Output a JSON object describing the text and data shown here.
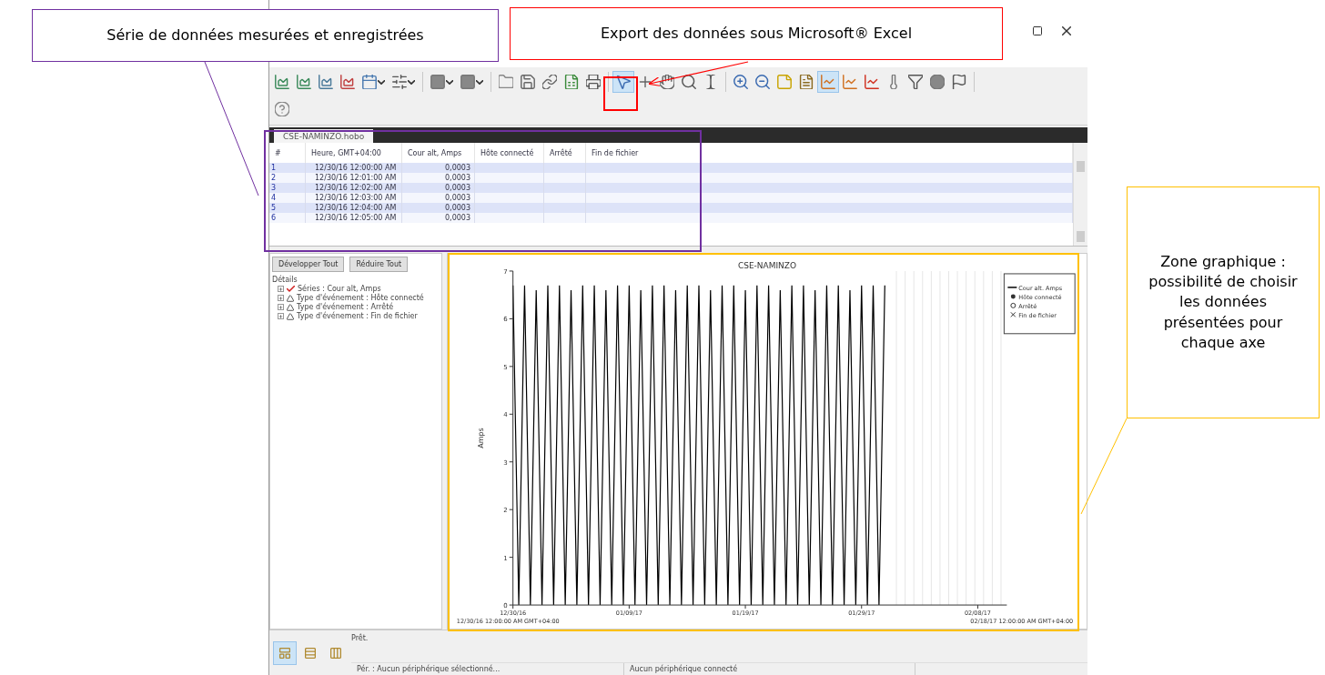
{
  "annotations": [
    {
      "text": "Série de données mesurées et enregistrées",
      "color": "#7030a0"
    },
    {
      "text": "Export des données sous Microsoft® Excel",
      "color": "#ff0000"
    },
    {
      "text": "Zone graphique : possibilité de choisir les données présentées pour chaque axe",
      "color": "#ffc000"
    }
  ],
  "toolbar_rows": [
    [
      {
        "selected": false
      },
      {
        "selected": false
      },
      {
        "selected": false
      },
      {
        "selected": false
      },
      {
        "selected": false
      },
      {
        "selected": false
      },
      {
        "selected": false
      },
      {
        "selected": false
      },
      {
        "selected": false
      },
      {
        "selected": false
      },
      {
        "selected": false
      },
      {
        "selected": false
      },
      {
        "selected": false
      },
      {
        "selected": true
      },
      {
        "selected": false
      },
      {
        "selected": false
      },
      {
        "selected": false
      },
      {
        "selected": false
      },
      {
        "selected": false
      },
      {
        "selected": false
      },
      {
        "selected": false
      },
      {
        "selected": false
      },
      {
        "selected": true
      },
      {
        "selected": false
      },
      {
        "selected": false
      },
      {
        "selected": false
      },
      {
        "selected": false
      },
      {
        "selected": false
      },
      {
        "selected": false
      }
    ],
    [
      {
        "selected": false
      }
    ]
  ],
  "document_tab": {
    "label": "CSE-NAMINZO.hobo",
    "selected": true
  },
  "table": {
    "columns": [
      "#",
      "Heure, GMT+04:00",
      "Cour alt, Amps",
      "Hôte connecté",
      "Arrêté",
      "Fin de fichier"
    ],
    "rows": [
      [
        "1",
        "12/30/16 12:00:00 AM",
        "0,0003",
        "",
        "",
        ""
      ],
      [
        "2",
        "12/30/16 12:01:00 AM",
        "0,0003",
        "",
        "",
        ""
      ],
      [
        "3",
        "12/30/16 12:02:00 AM",
        "0,0003",
        "",
        "",
        ""
      ],
      [
        "4",
        "12/30/16 12:03:00 AM",
        "0,0003",
        "",
        "",
        ""
      ],
      [
        "5",
        "12/30/16 12:04:00 AM",
        "0,0003",
        "",
        "",
        ""
      ],
      [
        "6",
        "12/30/16 12:05:00 AM",
        "0,0003",
        "",
        "",
        ""
      ]
    ]
  },
  "details": {
    "buttons": [
      "Développer Tout",
      "Réduire Tout"
    ],
    "heading": "Détails",
    "items": [
      {
        "kind": "series",
        "label": "Séries : Cour alt, Amps",
        "expanded": false
      },
      {
        "kind": "event",
        "label": "Type d'événement : Hôte connecté",
        "expanded": false
      },
      {
        "kind": "event",
        "label": "Type d'événement : Arrêté",
        "expanded": false
      },
      {
        "kind": "event",
        "label": "Type d'événement : Fin de fichier",
        "expanded": false
      }
    ]
  },
  "chart": {
    "start_label": "12/30/16 12:00:00 AM GMT+04:00",
    "end_label": "02/18/17 12:00:00 AM GMT+04:00",
    "legend": [
      {
        "kind": "star",
        "label": "Hôte connecté"
      },
      {
        "kind": "circle",
        "label": "Arrêté"
      },
      {
        "kind": "cross",
        "label": "Fin de fichier"
      }
    ],
    "chart_data": {
      "type": "line",
      "grid": true,
      "title": "CSE-NAMINZO",
      "ylabel": "Amps",
      "ylim": [
        0,
        7
      ],
      "yticks": [
        0,
        1,
        2,
        3,
        4,
        5,
        6,
        7
      ],
      "categories": [
        "12/30/16",
        null,
        null,
        null,
        null,
        null,
        null,
        null,
        null,
        null,
        null,
        null,
        null,
        null,
        null,
        null,
        null,
        null,
        null,
        null,
        "01/09/17",
        null,
        null,
        null,
        null,
        null,
        null,
        null,
        null,
        null,
        null,
        null,
        null,
        null,
        null,
        null,
        null,
        null,
        null,
        null,
        "01/19/17",
        null,
        null,
        null,
        null,
        null,
        null,
        null,
        null,
        null,
        null,
        null,
        null,
        null,
        null,
        null,
        null,
        null,
        null,
        null,
        "01/29/17",
        null,
        null,
        null,
        null,
        null,
        null,
        null,
        null,
        null,
        null,
        null,
        null,
        null,
        null,
        null,
        null,
        null,
        null,
        null,
        "02/08/17",
        null,
        null,
        null,
        null
      ],
      "series": [
        {
          "name": "Cour alt. Amps",
          "color": "#000000",
          "values": [
            6.7,
            0,
            6.7,
            0,
            6.6,
            0,
            6.7,
            0,
            6.7,
            0,
            6.6,
            0,
            6.7,
            0,
            6.7,
            0,
            6.6,
            0,
            6.7,
            0,
            6.7,
            0,
            6.6,
            0,
            6.7,
            0,
            6.7,
            0,
            6.6,
            0,
            6.7,
            0,
            6.7,
            0,
            6.6,
            0,
            6.7,
            0,
            6.7,
            0,
            6.6,
            0,
            6.7,
            0,
            6.7,
            0,
            6.6,
            0,
            6.7,
            0,
            6.7,
            0,
            6.6,
            0,
            6.7,
            0,
            6.7,
            0,
            6.6,
            0,
            6.7,
            0,
            6.7,
            0,
            6.7,
            null,
            null,
            null,
            null,
            null,
            null,
            null,
            null,
            null,
            null,
            null,
            null,
            null,
            null,
            null,
            null,
            null,
            null,
            null,
            null
          ]
        }
      ]
    }
  },
  "view_buttons": [
    {
      "selected": true
    },
    {
      "selected": false
    },
    {
      "selected": false
    }
  ],
  "status_bar": {
    "message": "Prêt.",
    "device": "Pér. : Aucun périphérique sélectionné...",
    "connection": "Aucun périphérique connecté"
  }
}
